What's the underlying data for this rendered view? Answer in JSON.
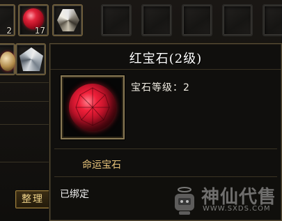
{
  "inventory": {
    "slot_counts": [
      "2",
      "17"
    ],
    "sort_label": "整理"
  },
  "tooltip": {
    "title": "红宝石(2级)",
    "level_text": "宝石等级：2",
    "category": "命运宝石",
    "bind_status": "已绑定"
  },
  "watermark": {
    "brand": "神仙代售",
    "url": "WWW.SXDS.COM"
  },
  "colors": {
    "tooltip_border": "#5a4e35",
    "category_text": "#e8c47a",
    "title_text": "#ffffff",
    "gem_red": "#e0243a"
  },
  "icons": {
    "slot1_item": "ruby-gem-icon",
    "slot2_item": "diamond-gem-icon",
    "slot3_item": "hex-gem-icon",
    "tooltip_item": "ruby-gem-icon"
  }
}
